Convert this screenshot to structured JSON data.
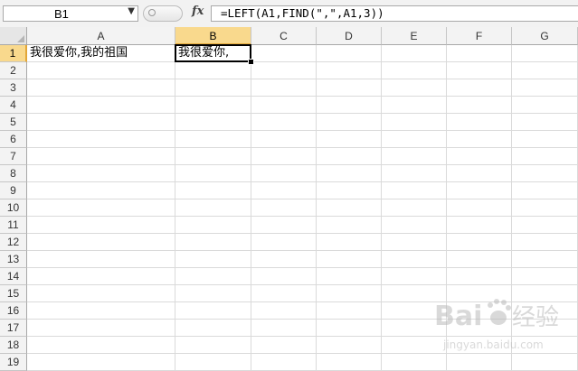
{
  "formula_bar": {
    "name_box": "B1",
    "fx_label": "fx",
    "formula": "=LEFT(A1,FIND(\",\",A1,3))"
  },
  "columns": [
    "A",
    "B",
    "C",
    "D",
    "E",
    "F",
    "G"
  ],
  "rows": [
    "1",
    "2",
    "3",
    "4",
    "5",
    "6",
    "7",
    "8",
    "9",
    "10",
    "11",
    "12",
    "13",
    "14",
    "15",
    "16",
    "17",
    "18",
    "19"
  ],
  "cells": {
    "A1": "我很爱你,我的祖国",
    "B1": "我很爱你,"
  },
  "active_cell": "B1",
  "watermark": {
    "brand": "Bai 经验",
    "url": "jingyan.baidu.com"
  },
  "colors": {
    "active_header": "#f9d98d",
    "active_header_border": "#e2a637",
    "gridline": "#dadada"
  }
}
